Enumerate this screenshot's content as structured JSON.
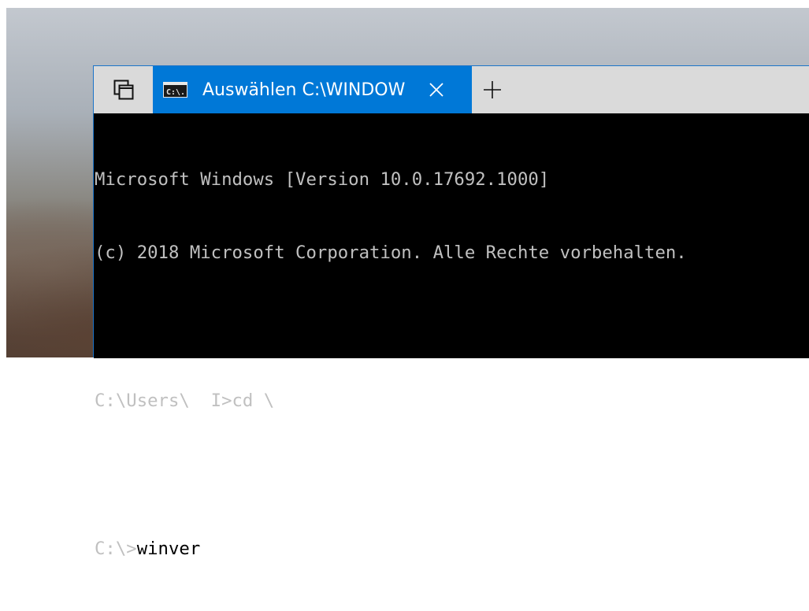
{
  "tabbar": {
    "tabs_icon": "tab-switcher-icon",
    "active_tab": {
      "icon": "cmd-icon",
      "icon_text": "C:\\.",
      "title": "Auswählen C:\\WINDOW",
      "close_icon": "close-icon"
    },
    "new_tab_icon": "plus-icon"
  },
  "console": {
    "lines": [
      "Microsoft Windows [Version 10.0.17692.1000]",
      "(c) 2018 Microsoft Corporation. Alle Rechte vorbehalten.",
      "",
      "C:\\Users\\  I>cd \\",
      ""
    ],
    "prompt": "C:\\>",
    "selected_input": "winver"
  },
  "colors": {
    "accent": "#0078d7",
    "tabbar_bg": "#dadada",
    "console_bg": "#000000",
    "console_fg": "#c0c0c0"
  }
}
